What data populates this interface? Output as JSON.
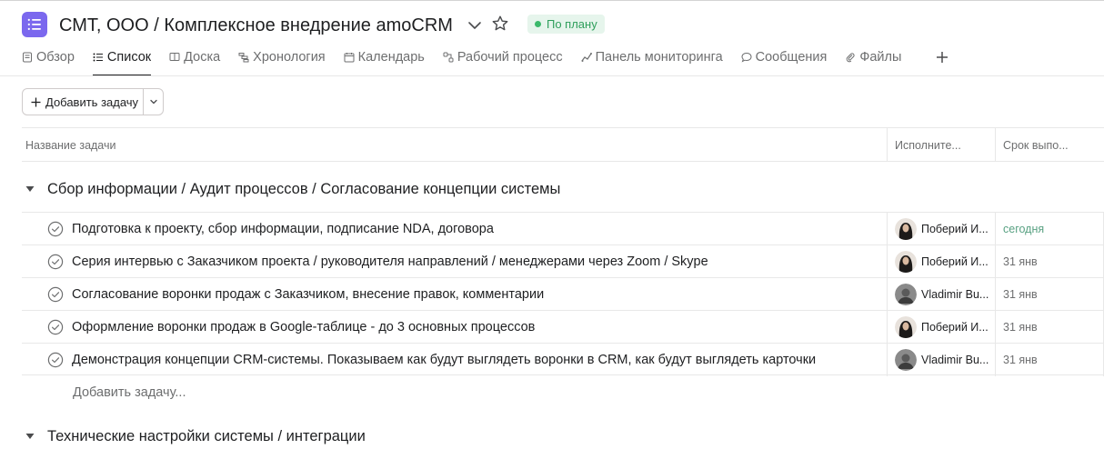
{
  "project": {
    "title": "СМТ, ООО / Комплексное внедрение amoCRM",
    "status": "По плану",
    "accent_color": "#7b68ee",
    "status_color": "#3bb96b"
  },
  "tabs": [
    {
      "label": "Обзор",
      "icon": "overview-icon"
    },
    {
      "label": "Список",
      "icon": "list-icon",
      "active": true
    },
    {
      "label": "Доска",
      "icon": "board-icon"
    },
    {
      "label": "Хронология",
      "icon": "timeline-icon"
    },
    {
      "label": "Календарь",
      "icon": "calendar-icon"
    },
    {
      "label": "Рабочий процесс",
      "icon": "workflow-icon"
    },
    {
      "label": "Панель мониторинга",
      "icon": "dashboard-icon"
    },
    {
      "label": "Сообщения",
      "icon": "messages-icon"
    },
    {
      "label": "Файлы",
      "icon": "files-icon"
    }
  ],
  "toolbar": {
    "add_task_label": "Добавить задачу"
  },
  "columns": {
    "name": "Название задачи",
    "assignee": "Исполните...",
    "due": "Срок выпо..."
  },
  "sections": [
    {
      "title": "Сбор информации / Аудит процессов / Согласование концепции системы",
      "tasks": [
        {
          "name": "Подготовка к проекту, сбор информации, подписание NDA, договора",
          "assignee": "Поберий И...",
          "due": "сегодня",
          "due_today": true
        },
        {
          "name": "Серия интервью  с Заказчиком проекта / руководителя направлений / менеджерами через Zoom / Skype",
          "assignee": "Поберий И...",
          "due": "31 янв"
        },
        {
          "name": "Согласование воронки продаж с Заказчиком, внесение правок, комментарии",
          "assignee": "Vladimir Bu...",
          "due": "31 янв"
        },
        {
          "name": "Оформление воронки продаж в Google-таблице - до 3 основных процессов",
          "assignee": "Поберий И...",
          "due": "31 янв"
        },
        {
          "name": "Демонстрация концепции CRM-системы. Показываем как будут выглядеть воронки в CRM, как будут выглядеть карточки",
          "assignee": "Vladimir Bu...",
          "due": "31 янв"
        }
      ],
      "add_task_placeholder": "Добавить задачу..."
    },
    {
      "title": "Технические настройки системы / интеграции",
      "tasks": []
    }
  ]
}
